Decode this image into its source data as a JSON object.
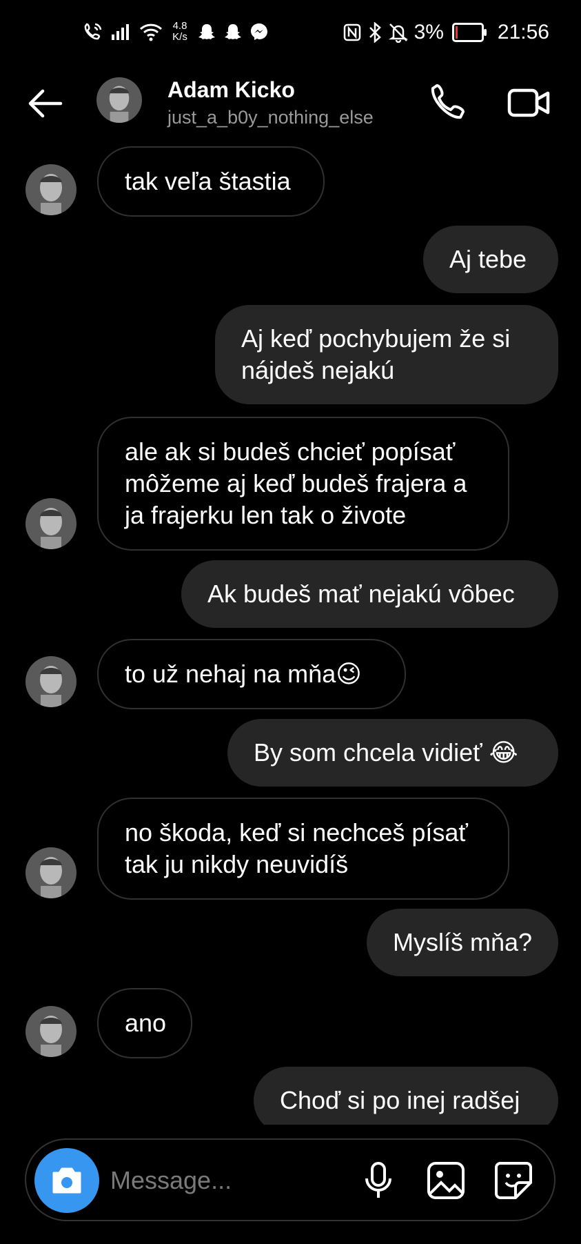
{
  "status_bar": {
    "speed_value": "4.8",
    "speed_unit": "K/s",
    "battery": "3%",
    "time": "21:56",
    "icons": [
      "wifi-call-icon",
      "signal-icon",
      "wifi-icon",
      "snapchat-icon",
      "snapchat-icon",
      "messenger-icon",
      "nfc-icon",
      "bluetooth-icon",
      "mute-icon",
      "battery-icon"
    ]
  },
  "header": {
    "name": "Adam Kicko",
    "username": "just_a_b0y_nothing_else"
  },
  "messages": [
    {
      "from": "them",
      "text": "tak veľa štastia"
    },
    {
      "from": "me",
      "text": "Aj tebe"
    },
    {
      "from": "me",
      "lines": [
        "Aj keď pochybujem že si",
        "nájdeš nejakú"
      ]
    },
    {
      "from": "them",
      "lines": [
        "ale ak si budeš chcieť popísať",
        "môžeme aj keď budeš frajera a",
        "ja frajerku len tak o živote"
      ]
    },
    {
      "from": "me",
      "text": "Ak budeš mať nejakú vôbec"
    },
    {
      "from": "them",
      "text": "to už nehaj na mňa😉"
    },
    {
      "from": "me",
      "text": "By som chcela vidieť 😂"
    },
    {
      "from": "them",
      "lines": [
        "no škoda, keď si nechceš písať",
        "tak ju nikdy neuvidíš"
      ]
    },
    {
      "from": "me",
      "text": "Myslíš mňa?"
    },
    {
      "from": "them",
      "text": "ano"
    },
    {
      "from": "me",
      "text": "Choď si po inej radšej"
    }
  ],
  "composer": {
    "placeholder": "Message..."
  },
  "colors": {
    "background": "#000000",
    "outgoing_bubble": "#262626",
    "incoming_border": "#303030",
    "accent": "#3797f0"
  }
}
